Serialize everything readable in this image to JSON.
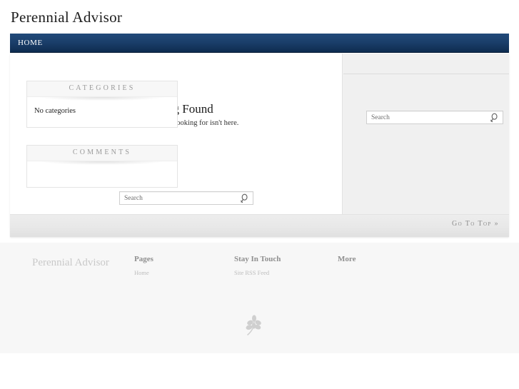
{
  "site": {
    "title": "Perennial Advisor"
  },
  "nav": {
    "items": [
      {
        "label": "HOME",
        "name": "nav-item-home"
      }
    ]
  },
  "content": {
    "heading": "Nothing Found",
    "subtext": "Sorry, what you are looking for isn't here.",
    "search": {
      "placeholder": "Search",
      "value": "",
      "icon": "search-icon"
    }
  },
  "sidebar": {
    "search": {
      "placeholder": "Search",
      "value": "",
      "icon": "search-icon"
    },
    "widgets": [
      {
        "title": "CATEGORIES",
        "body": "No categories"
      },
      {
        "title": "COMMENTS",
        "body": ""
      }
    ]
  },
  "gototop": {
    "label": "Go To Top »"
  },
  "footer": {
    "brand": "Perennial Advisor",
    "columns": [
      {
        "title": "Pages",
        "links": [
          "Home"
        ]
      },
      {
        "title": "Stay In Touch",
        "links": [
          "Site RSS Feed"
        ]
      },
      {
        "title": "More",
        "links": []
      }
    ],
    "leaf_icon": "leaf-icon"
  },
  "colors": {
    "nav_top": "#214a7a",
    "nav_bottom": "#0e2c50",
    "page_bg": "#ffffff",
    "sidebar_bg": "#f0f0f0",
    "footer_bg": "#f7f7f7",
    "muted_text": "#9a9a9a"
  }
}
